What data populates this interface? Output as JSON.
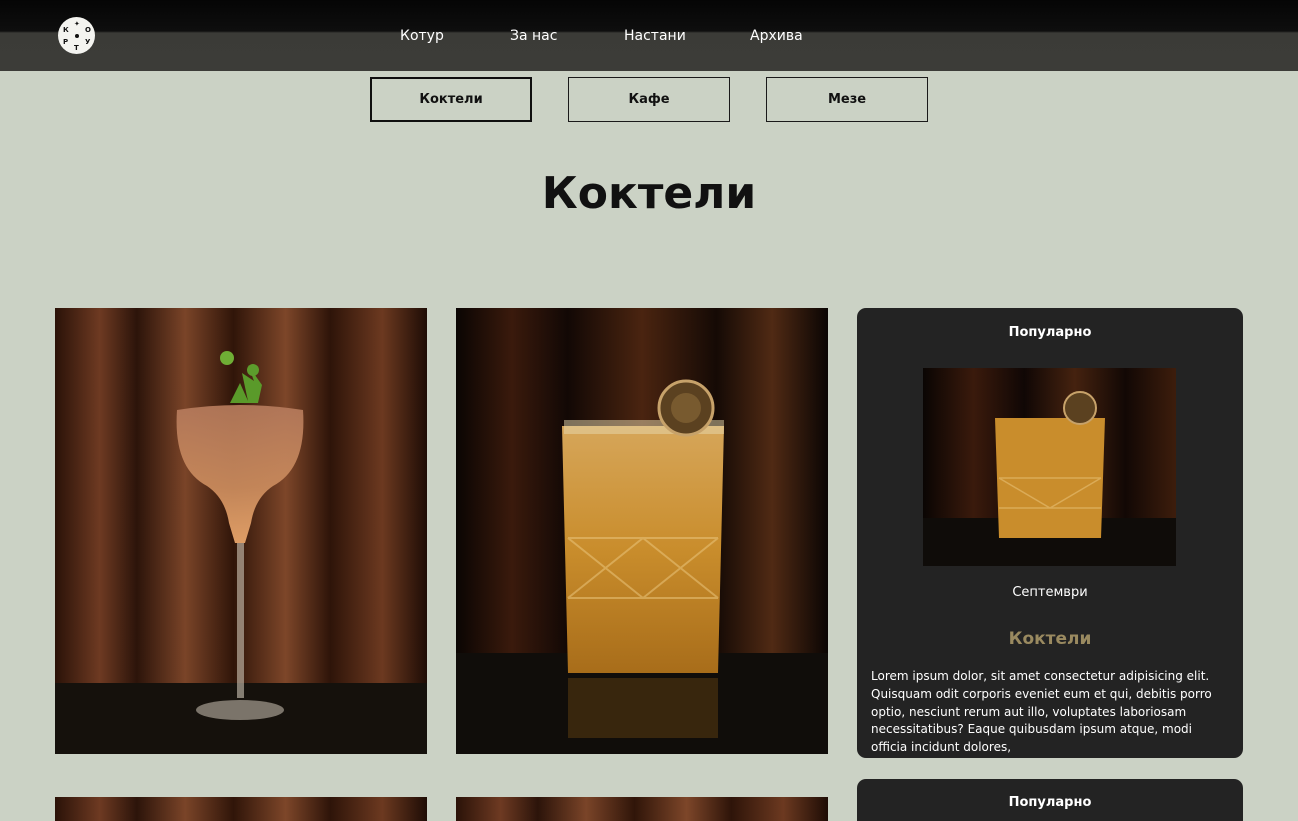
{
  "header": {
    "logo_icon": "round-logo",
    "nav": [
      "Котур",
      "За нас",
      "Настани",
      "Архива"
    ]
  },
  "categories": [
    {
      "label": "Коктели",
      "active": true
    },
    {
      "label": "Кафе",
      "active": false
    },
    {
      "label": "Мезе",
      "active": false
    }
  ],
  "main": {
    "title": "Коктели"
  },
  "popular": [
    {
      "heading": "Популарно",
      "date": "Септември",
      "category": "Коктели",
      "text": "Lorem ipsum dolor, sit amet consectetur adipisicing elit. Quisquam odit corporis eveniet eum et qui, debitis porro optio, nesciunt rerum aut illo, voluptates laboriosam necessitatibus? Eaque quibusdam ipsum atque, modi officia incidunt dolores,"
    },
    {
      "heading": "Популарно"
    }
  ],
  "colors": {
    "background": "#cbd2c5",
    "header": "#3c3c38",
    "card": "#232323",
    "accent": "#9a8a60"
  }
}
